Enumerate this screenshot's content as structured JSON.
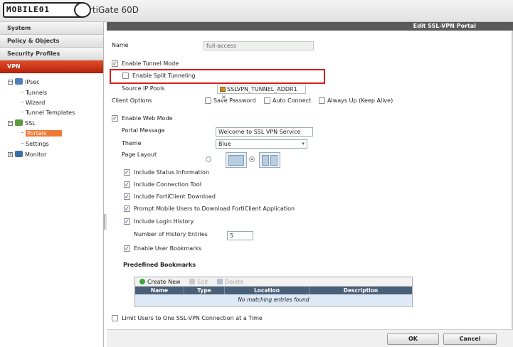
{
  "top": {
    "logo_text": "MOBILE01",
    "product_title": "rtiGate 60D"
  },
  "sidebar": {
    "sections": [
      "System",
      "Policy & Objects",
      "Security Profiles",
      "VPN"
    ],
    "tree": [
      {
        "label": "IPsec",
        "children": [
          "Tunnels",
          "Wizard",
          "Tunnel Templates"
        ]
      },
      {
        "label": "SSL",
        "children": [
          "Portals",
          "Settings"
        ]
      },
      {
        "label": "Monitor",
        "children": []
      }
    ],
    "selected": "Portals"
  },
  "panel": {
    "title": "Edit SSL-VPN Portal",
    "name_label": "Name",
    "name_value": "full-access",
    "enable_tunnel_mode": "Enable Tunnel Mode",
    "enable_split_tunneling": "Enable Split Tunneling",
    "source_ip_pools_label": "Source IP Pools",
    "source_ip_pool_value": "SSLVPN_TUNNEL_ADDR1",
    "chip_remove": "×",
    "client_options_label": "Client Options",
    "client_options": [
      "Save Password",
      "Auto Connect",
      "Always Up (Keep Alive)"
    ],
    "enable_web_mode": "Enable Web Mode",
    "portal_message_label": "Portal Message",
    "portal_message_value": "Welcome to SSL VPN Service",
    "theme_label": "Theme",
    "theme_value": "Blue",
    "page_layout_label": "Page Layout",
    "options": [
      "Include Status Information",
      "Include Connection Tool",
      "Include FortiClient Download",
      "Prompt Mobile Users to Download FortiClient Application",
      "Include Login History"
    ],
    "history_entries_label": "Number of History Entries",
    "history_entries_value": "5",
    "enable_user_bookmarks": "Enable User Bookmarks",
    "predefined_bookmarks_title": "Predefined Bookmarks",
    "toolbar": {
      "create": "Create New",
      "edit": "Edit",
      "delete": "Delete"
    },
    "columns": [
      "Name",
      "Type",
      "Location",
      "Description"
    ],
    "empty_message": "No matching entries found",
    "limit_users": "Limit Users to One SSL-VPN Connection at a Time",
    "ok_label": "OK",
    "cancel_label": "Cancel"
  },
  "colors": {
    "vpn_active": "#c8300e",
    "highlight_box": "#d11e1e",
    "table_header": "#4a5f78",
    "selected_item": "#ef7a38"
  }
}
